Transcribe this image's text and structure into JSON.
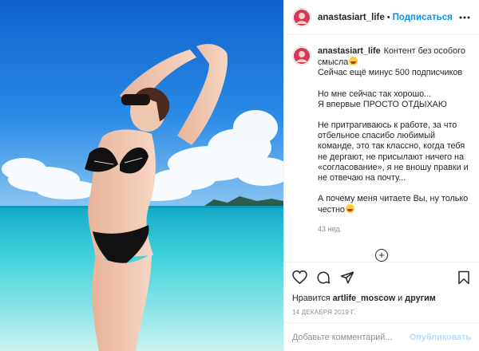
{
  "post": {
    "username": "anastasiart_life",
    "follow_label": "Подписаться",
    "separator": "•",
    "icons": {
      "more": "more-dots-icon",
      "like": "heart-icon",
      "comment": "comment-bubble-icon",
      "share": "paper-plane-icon",
      "save": "bookmark-icon",
      "load_more": "plus-circle-icon"
    },
    "caption": {
      "username": "anastasiart_life",
      "line1": "Контент без особого смысла",
      "line2": "Сейчас ещё минус 500 подписчиков",
      "para2_line1": "Но мне сейчас так хорошо...",
      "para2_line2": "Я впервые ПРОСТО ОТДЫХАЮ",
      "para3": "Не притрагиваюсь к работе, за что отбельное спасибо любимый команде, это так классно, когда тебя не дергают, не присылают ничего на «согласование», я не вношу правки и не отвечаю на почту...",
      "para4": "А почему меня читаете Вы, ну только честно"
    },
    "time_ago": "43 нед.",
    "likes": {
      "prefix": "Нравится",
      "user": "artlife_moscow",
      "middle": "и",
      "others": "другим"
    },
    "date": "14 ДЕКАБРЯ 2019 Г.",
    "comment": {
      "placeholder": "Добавьте комментарий...",
      "value": "",
      "publish_label": "Опубликовать"
    },
    "colors": {
      "accent": "#0095f6",
      "publish_disabled": "#b3dbff",
      "text": "#262626",
      "muted": "#8e8e8e",
      "sky": "#1a72d6",
      "sea": "#2ec4d8"
    }
  }
}
